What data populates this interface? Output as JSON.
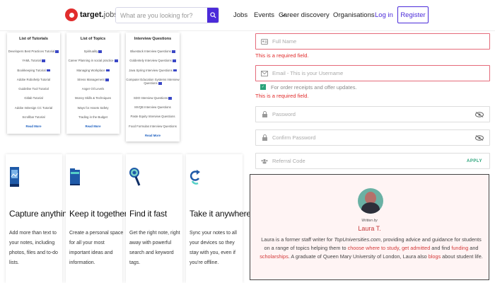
{
  "header": {
    "logo_text": "target",
    "logo_sub": "jobs",
    "search_placeholder": "What are you looking for?",
    "nav": [
      "Jobs",
      "Events",
      "Career discovery",
      "Organisations"
    ],
    "login": "Log in",
    "register": "Register"
  },
  "menus": [
    {
      "title": "List of Tutorials",
      "items": [
        "Developers Best Practices Tutorial",
        "YAML Tutorial",
        "Bookkeeping Tutorial",
        "Adobe Robohelp Tutorial",
        "Guideline Tool Tutorial",
        "Gitlab Tutorial",
        "Adobe InDesign CC Tutorial",
        "Scrollbar Tutorial"
      ],
      "read_more": "Read More"
    },
    {
      "title": "List of Topics",
      "items": [
        "Spirituality",
        "Career Planning in social practice",
        "Managing Workplace",
        "Stress Management",
        "Anger Oil Levels",
        "Money Skills & Techniques",
        "Ways for Assets Safety",
        "Trading in the Budget"
      ],
      "read_more": "Read More"
    },
    {
      "title": "Interview Questions",
      "items": [
        "Bluestack Interview Questions",
        "Goldentely Interview Questions",
        "Java Spring Interview Questions",
        "Computer Education Systems Interview Questions",
        "SDO Interview Questions",
        "MVQB Interview Questions",
        "Paste Equity Interview Questions",
        "Food Formulas Interview Questions"
      ],
      "read_more": "Read More"
    }
  ],
  "features": [
    {
      "title": "Capture anything",
      "desc": "Add more than text to your notes, including photos, files and to-do lists.",
      "icon": "image-document-icon"
    },
    {
      "title": "Keep it together",
      "desc": "Create a personal space for all your most important ideas and information.",
      "icon": "folder-icon"
    },
    {
      "title": "Find it fast",
      "desc": "Get the right note, right away with powerful search and keyword tags.",
      "icon": "magnifier-icon"
    },
    {
      "title": "Take it anywhere",
      "desc": "Sync your notes to all your devices so they stay with you, even if you're offline.",
      "icon": "sync-icon"
    }
  ],
  "form": {
    "full_name_placeholder": "Full Name",
    "email_placeholder": "Email - This is your Username",
    "required_error": "This is a required field.",
    "order_updates_label": "For order receipts and offer updates.",
    "password_placeholder": "Password",
    "confirm_password_placeholder": "Confirm Password",
    "referral_placeholder": "Referral Code",
    "apply": "APPLY"
  },
  "author": {
    "written_by": "Written by",
    "name": "Laura T.",
    "bio_1": "Laura is a former staff writer for ",
    "bio_site": "TopUniversities.com",
    "bio_2": ", providing advice and guidance for students on a range of topics helping them to ",
    "bio_link1": "choose where to study",
    "bio_3": ", ",
    "bio_link2": "get admitted",
    "bio_4": " and find ",
    "bio_link3": "funding",
    "bio_5": " and ",
    "bio_link4": "scholarships",
    "bio_6": ". A graduate of Queen Mary University of London, Laura also ",
    "bio_link5": "blogs",
    "bio_7": " about student life."
  },
  "colors": {
    "brand": "#4b2bd9",
    "error": "#e12d2d",
    "accent": "#2aa37a"
  }
}
